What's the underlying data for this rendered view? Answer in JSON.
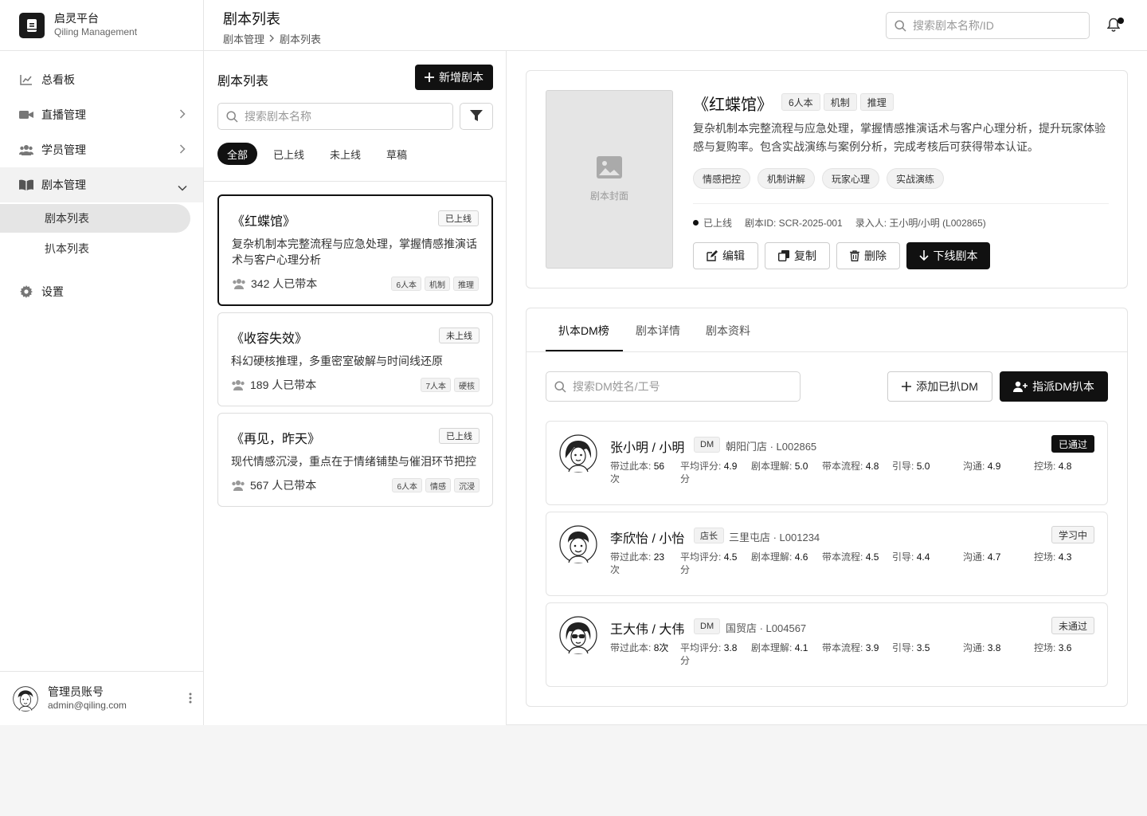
{
  "brand": {
    "name": "启灵平台",
    "sub": "Qiling Management"
  },
  "nav": {
    "dashboard": "总看板",
    "live": "直播管理",
    "students": "学员管理",
    "scripts": "剧本管理",
    "script_list": "剧本列表",
    "reading_list": "扒本列表",
    "settings": "设置"
  },
  "user": {
    "name": "管理员账号",
    "email": "admin@qiling.com"
  },
  "header": {
    "title": "剧本列表",
    "crumb1": "剧本管理",
    "crumb2": "剧本列表",
    "search_placeholder": "搜索剧本名称/ID"
  },
  "list": {
    "title": "剧本列表",
    "new_button": "新增剧本",
    "search_placeholder": "搜索剧本名称",
    "filters": [
      "全部",
      "已上线",
      "未上线",
      "草稿"
    ],
    "cards": [
      {
        "title": "《红蝶馆》",
        "status": "已上线",
        "desc": "复杂机制本完整流程与应急处理，掌握情感推演话术与客户心理分析",
        "count": "342 人已带本",
        "tags": [
          "6人本",
          "机制",
          "推理"
        ]
      },
      {
        "title": "《收容失效》",
        "status": "未上线",
        "desc": "科幻硬核推理，多重密室破解与时间线还原",
        "count": "189 人已带本",
        "tags": [
          "7人本",
          "硬核"
        ]
      },
      {
        "title": "《再见，昨天》",
        "status": "已上线",
        "desc": "现代情感沉浸，重点在于情绪铺垫与催泪环节把控",
        "count": "567 人已带本",
        "tags": [
          "6人本",
          "情感",
          "沉浸"
        ]
      }
    ]
  },
  "detail": {
    "cover_label": "剧本封面",
    "title": "《红蝶馆》",
    "tags": [
      "6人本",
      "机制",
      "推理"
    ],
    "desc": "复杂机制本完整流程与应急处理，掌握情感推演话术与客户心理分析，提升玩家体验感与复购率。包含实战演练与案例分析，完成考核后可获得带本认证。",
    "labels": [
      "情感把控",
      "机制讲解",
      "玩家心理",
      "实战演练"
    ],
    "status": "已上线",
    "id": "剧本ID: SCR-2025-001",
    "author": "录入人: 王小明/小明 (L002865)",
    "actions": {
      "edit": "编辑",
      "copy": "复制",
      "delete": "删除",
      "offline": "下线剧本"
    }
  },
  "dm": {
    "tabs": [
      "扒本DM榜",
      "剧本详情",
      "剧本资料"
    ],
    "search_placeholder": "搜索DM姓名/工号",
    "add_button": "添加已扒DM",
    "assign_button": "指派DM扒本",
    "rows": [
      {
        "name": "张小明 / 小明",
        "role": "DM",
        "store": "朝阳门店 · L002865",
        "status": "已通过",
        "times_label": "带过此本:",
        "times": "56",
        "times_unit": "次",
        "avg_label": "平均评分:",
        "avg": "4.9",
        "avg_unit": "分",
        "s1_label": "剧本理解:",
        "s1": "5.0",
        "s2_label": "带本流程:",
        "s2": "4.8",
        "s3_label": "引导:",
        "s3": "5.0",
        "s4_label": "沟通:",
        "s4": "4.9",
        "s5_label": "控场:",
        "s5": "4.8"
      },
      {
        "name": "李欣怡 / 小怡",
        "role": "店长",
        "store": "三里屯店 · L001234",
        "status": "学习中",
        "times_label": "带过此本:",
        "times": "23",
        "times_unit": "次",
        "avg_label": "平均评分:",
        "avg": "4.5",
        "avg_unit": "分",
        "s1_label": "剧本理解:",
        "s1": "4.6",
        "s2_label": "带本流程:",
        "s2": "4.5",
        "s3_label": "引导:",
        "s3": "4.4",
        "s4_label": "沟通:",
        "s4": "4.7",
        "s5_label": "控场:",
        "s5": "4.3"
      },
      {
        "name": "王大伟 / 大伟",
        "role": "DM",
        "store": "国贸店 · L004567",
        "status": "未通过",
        "times_label": "带过此本:",
        "times": "8次",
        "times_unit": "",
        "avg_label": "平均评分:",
        "avg": "3.8",
        "avg_unit": "分",
        "s1_label": "剧本理解:",
        "s1": "4.1",
        "s2_label": "带本流程:",
        "s2": "3.9",
        "s3_label": "引导:",
        "s3": "3.5",
        "s4_label": "沟通:",
        "s4": "3.8",
        "s5_label": "控场:",
        "s5": "3.6"
      }
    ]
  }
}
